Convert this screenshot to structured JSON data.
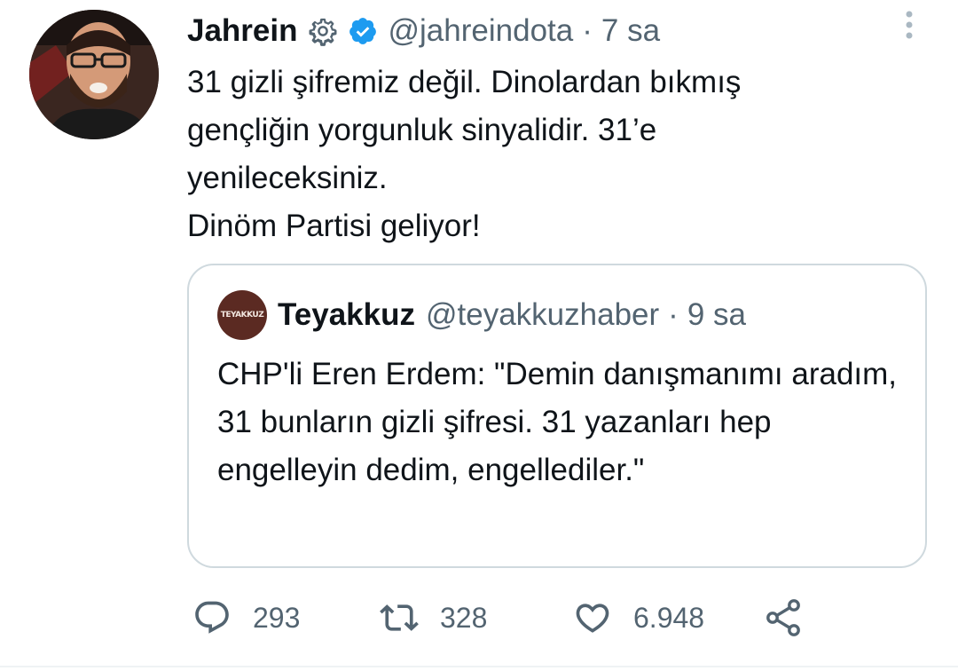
{
  "tweet": {
    "display_name": "Jahrein",
    "badges": [
      "gear-icon",
      "verified-icon"
    ],
    "handle": "@jahreindota",
    "separator": "·",
    "time": "7 sa",
    "text": "31 gizli şifremiz değil. Dinolardan bıkmış\ngençliğin yorgunluk sinyalidir. 31’e\nyenileceksiniz.\nDinöm Partisi geliyor!",
    "colors": {
      "text": "#0f1419",
      "secondary": "#536471",
      "verified": "#1d9bf0",
      "border": "#cfd9de"
    }
  },
  "quote": {
    "avatar_text": "TEYAKKUZ",
    "display_name": "Teyakkuz",
    "handle": "@teyakkuzhaber",
    "separator": "·",
    "time": "9 sa",
    "text": "CHP'li Eren Erdem: \"Demin danışmanımı aradım, 31 bunların gizli şifresi. 31 yazanları hep engelleyin dedim, engellediler.\""
  },
  "actions": {
    "reply": {
      "icon": "reply-icon",
      "count": "293"
    },
    "retweet": {
      "icon": "retweet-icon",
      "count": "328"
    },
    "like": {
      "icon": "heart-icon",
      "count": "6.948"
    },
    "share": {
      "icon": "share-icon"
    }
  }
}
